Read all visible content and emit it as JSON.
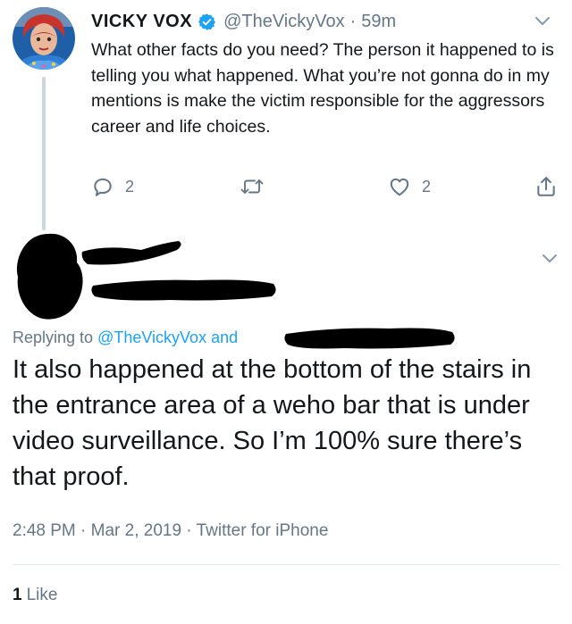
{
  "parent_tweet": {
    "display_name": "VICKY VOX",
    "handle": "@TheVickyVox",
    "separator": "·",
    "time": "59m",
    "text": "What other facts do you need? The person it happened to is telling you what happened. What you’re not gonna do in my mentions is make the victim responsible for the aggressors career and life choices.",
    "actions": {
      "reply_count": "2",
      "retweet_count": "",
      "like_count": "2"
    },
    "verified_color": "#1da1f2"
  },
  "reply_tweet": {
    "replying_prefix": "Replying to",
    "replying_mention": "@TheVickyVox",
    "replying_suffix": "and",
    "text": "It also happened at the bottom of the stairs in the entrance area of a weho bar that is under video surveillance. So I’m 100% sure there’s that proof.",
    "timestamp": "2:48 PM · Mar 2, 2019 · Twitter for iPhone",
    "like_count": "1",
    "like_label": "Like"
  },
  "colors": {
    "text": "#14171a",
    "secondary": "#657786",
    "link": "#1da1f2",
    "divider": "#e1e8ed",
    "thread_line": "#ccd6dd"
  }
}
